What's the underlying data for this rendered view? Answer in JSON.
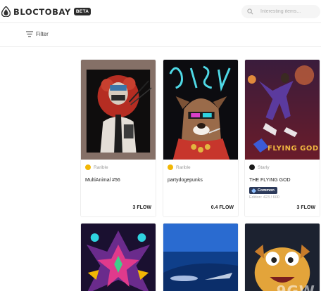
{
  "header": {
    "brand": "BLOCTOBAY",
    "badge": "BETA",
    "search_placeholder": "Interesting items..."
  },
  "toolbar": {
    "filter_label": "Filter"
  },
  "cards": [
    {
      "creator": "Rarible",
      "title": "MultiAnimal #56",
      "price": "3 FLOW",
      "art": "masked samurai illustration"
    },
    {
      "creator": "Rarible",
      "title": "partydogepunks",
      "price": "0.4 FLOW",
      "art": "neon dog with sunglasses"
    },
    {
      "creator": "Starly",
      "title": "THE FLYING GOD",
      "rarity": "Common",
      "edition": "Edition: 423 / 600",
      "price": "3 FLOW",
      "art_text": "FLYING GOD"
    },
    {
      "art": "kaleidoscope pattern"
    },
    {
      "art": "blue abstract"
    },
    {
      "art": "cartoon creature"
    }
  ],
  "colors": {
    "accent": "#2b2b2b",
    "badge_bg": "#2c3a5a",
    "rarible_icon": "#f2b705",
    "starly_icon": "#1a1a1a"
  }
}
